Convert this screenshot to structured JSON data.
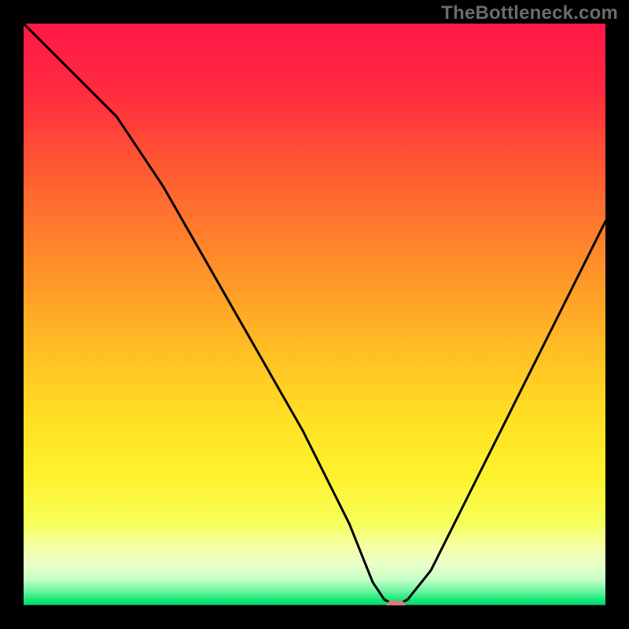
{
  "attribution": "TheBottleneck.com",
  "chart_data": {
    "type": "line",
    "title": "",
    "xlabel": "",
    "ylabel": "",
    "xlim": [
      0,
      100
    ],
    "ylim": [
      0,
      100
    ],
    "x": [
      0,
      8,
      16,
      24,
      32,
      40,
      48,
      56,
      60,
      62,
      64,
      66,
      70,
      76,
      84,
      92,
      100
    ],
    "values": [
      100,
      92,
      84,
      72,
      58,
      44,
      30,
      14,
      4,
      1,
      0,
      1,
      6,
      18,
      34,
      50,
      66
    ],
    "marker": {
      "x": 64,
      "y": 0,
      "color": "#d67a7a"
    },
    "background_gradient": {
      "stops": [
        {
          "pos": 0.0,
          "color": "#ff1846"
        },
        {
          "pos": 0.12,
          "color": "#ff2b3f"
        },
        {
          "pos": 0.25,
          "color": "#ff5a32"
        },
        {
          "pos": 0.4,
          "color": "#ff8a2a"
        },
        {
          "pos": 0.55,
          "color": "#ffba24"
        },
        {
          "pos": 0.68,
          "color": "#ffe024"
        },
        {
          "pos": 0.78,
          "color": "#fff22e"
        },
        {
          "pos": 0.86,
          "color": "#f6ff5b"
        },
        {
          "pos": 0.9,
          "color": "#f5ffaa"
        },
        {
          "pos": 0.93,
          "color": "#e9ffc8"
        },
        {
          "pos": 0.955,
          "color": "#c8ffc8"
        },
        {
          "pos": 0.975,
          "color": "#6cf5a0"
        },
        {
          "pos": 0.99,
          "color": "#17e878"
        },
        {
          "pos": 1.0,
          "color": "#0bd46a"
        }
      ]
    }
  }
}
